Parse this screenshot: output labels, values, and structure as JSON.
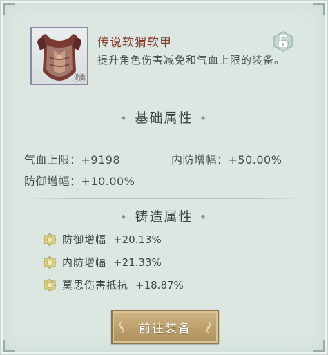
{
  "item": {
    "name": "传说软猬软甲",
    "description": "提升角色伤害减免和气血上限的装备。",
    "level_badge": "58",
    "icon": "armor-icon",
    "lock_icon": "unlock-icon"
  },
  "base_section": {
    "title": "基础属性",
    "attributes": [
      {
        "label": "气血上限：+9198"
      },
      {
        "label": "内防增幅：+50.00%"
      },
      {
        "label": "防御增幅：+10.00%"
      }
    ]
  },
  "forge_section": {
    "title": "铸造属性",
    "attributes": [
      {
        "name": "防御增幅",
        "value": "+20.13%"
      },
      {
        "name": "内防增幅",
        "value": "+21.33%"
      },
      {
        "name": "莫思伤害抵抗",
        "value": "+18.87%"
      }
    ]
  },
  "action": {
    "goto_equip_label": "前往装备"
  },
  "colors": {
    "panel_bg": "#dde7e2",
    "item_name": "#8a3a2c",
    "button_gold": "#bba06b"
  }
}
